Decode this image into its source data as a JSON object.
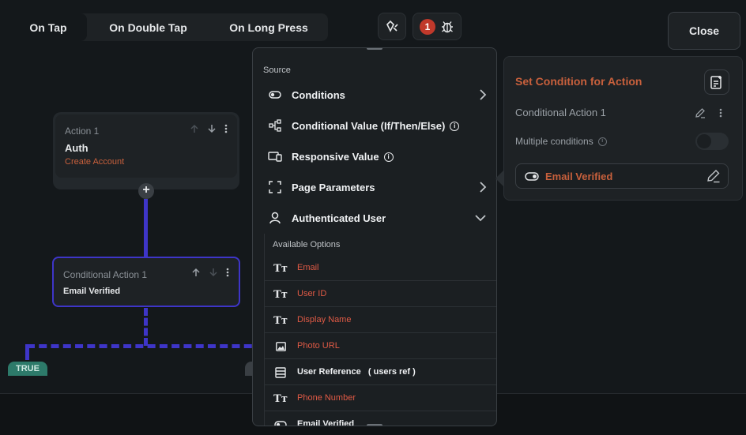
{
  "tabs": [
    {
      "label": "On Tap",
      "active": true
    },
    {
      "label": "On Double Tap",
      "active": false
    },
    {
      "label": "On Long Press",
      "active": false
    }
  ],
  "toolbar": {
    "debug_badge_count": "1",
    "close_label": "Close"
  },
  "canvas": {
    "action1": {
      "label": "Action 1",
      "title": "Auth",
      "subtitle": "Create Account"
    },
    "conditional": {
      "label": "Conditional Action 1",
      "title": "Email Verified"
    },
    "true_chip": "TRUE"
  },
  "dropdown": {
    "source_label": "Source",
    "items": [
      {
        "label": "Conditions",
        "icon": "toggle-icon",
        "right": "chevron-right"
      },
      {
        "label": "Conditional Value (If/Then/Else)",
        "icon": "flow-icon",
        "info": true
      },
      {
        "label": "Responsive Value",
        "icon": "devices-icon",
        "info": true
      },
      {
        "label": "Page Parameters",
        "icon": "page-params-icon",
        "right": "chevron-right"
      },
      {
        "label": "Authenticated User",
        "icon": "user-icon",
        "right": "chevron-down"
      }
    ],
    "available_options_label": "Available Options",
    "options": [
      {
        "label": "Email",
        "icon": "text-type-icon"
      },
      {
        "label": "User ID",
        "icon": "text-type-icon"
      },
      {
        "label": "Display Name",
        "icon": "text-type-icon"
      },
      {
        "label": "Photo URL",
        "icon": "image-icon"
      },
      {
        "label": "User Reference   ( users ref )",
        "icon": "reference-icon"
      },
      {
        "label": "Phone Number",
        "icon": "text-type-icon"
      },
      {
        "label": "Email Verified",
        "icon": "toggle-icon"
      }
    ]
  },
  "right_panel": {
    "title": "Set Condition for Action",
    "condition_name": "Conditional Action 1",
    "multiple_conditions_label": "Multiple conditions",
    "multiple_conditions_enabled": false,
    "selected_condition": "Email Verified"
  },
  "colors": {
    "accent_orange": "#c8603c",
    "option_red": "#e05a45",
    "flow_purple": "#3e35c8",
    "true_green": "#2d7a6a",
    "badge_red": "#c0392b"
  }
}
